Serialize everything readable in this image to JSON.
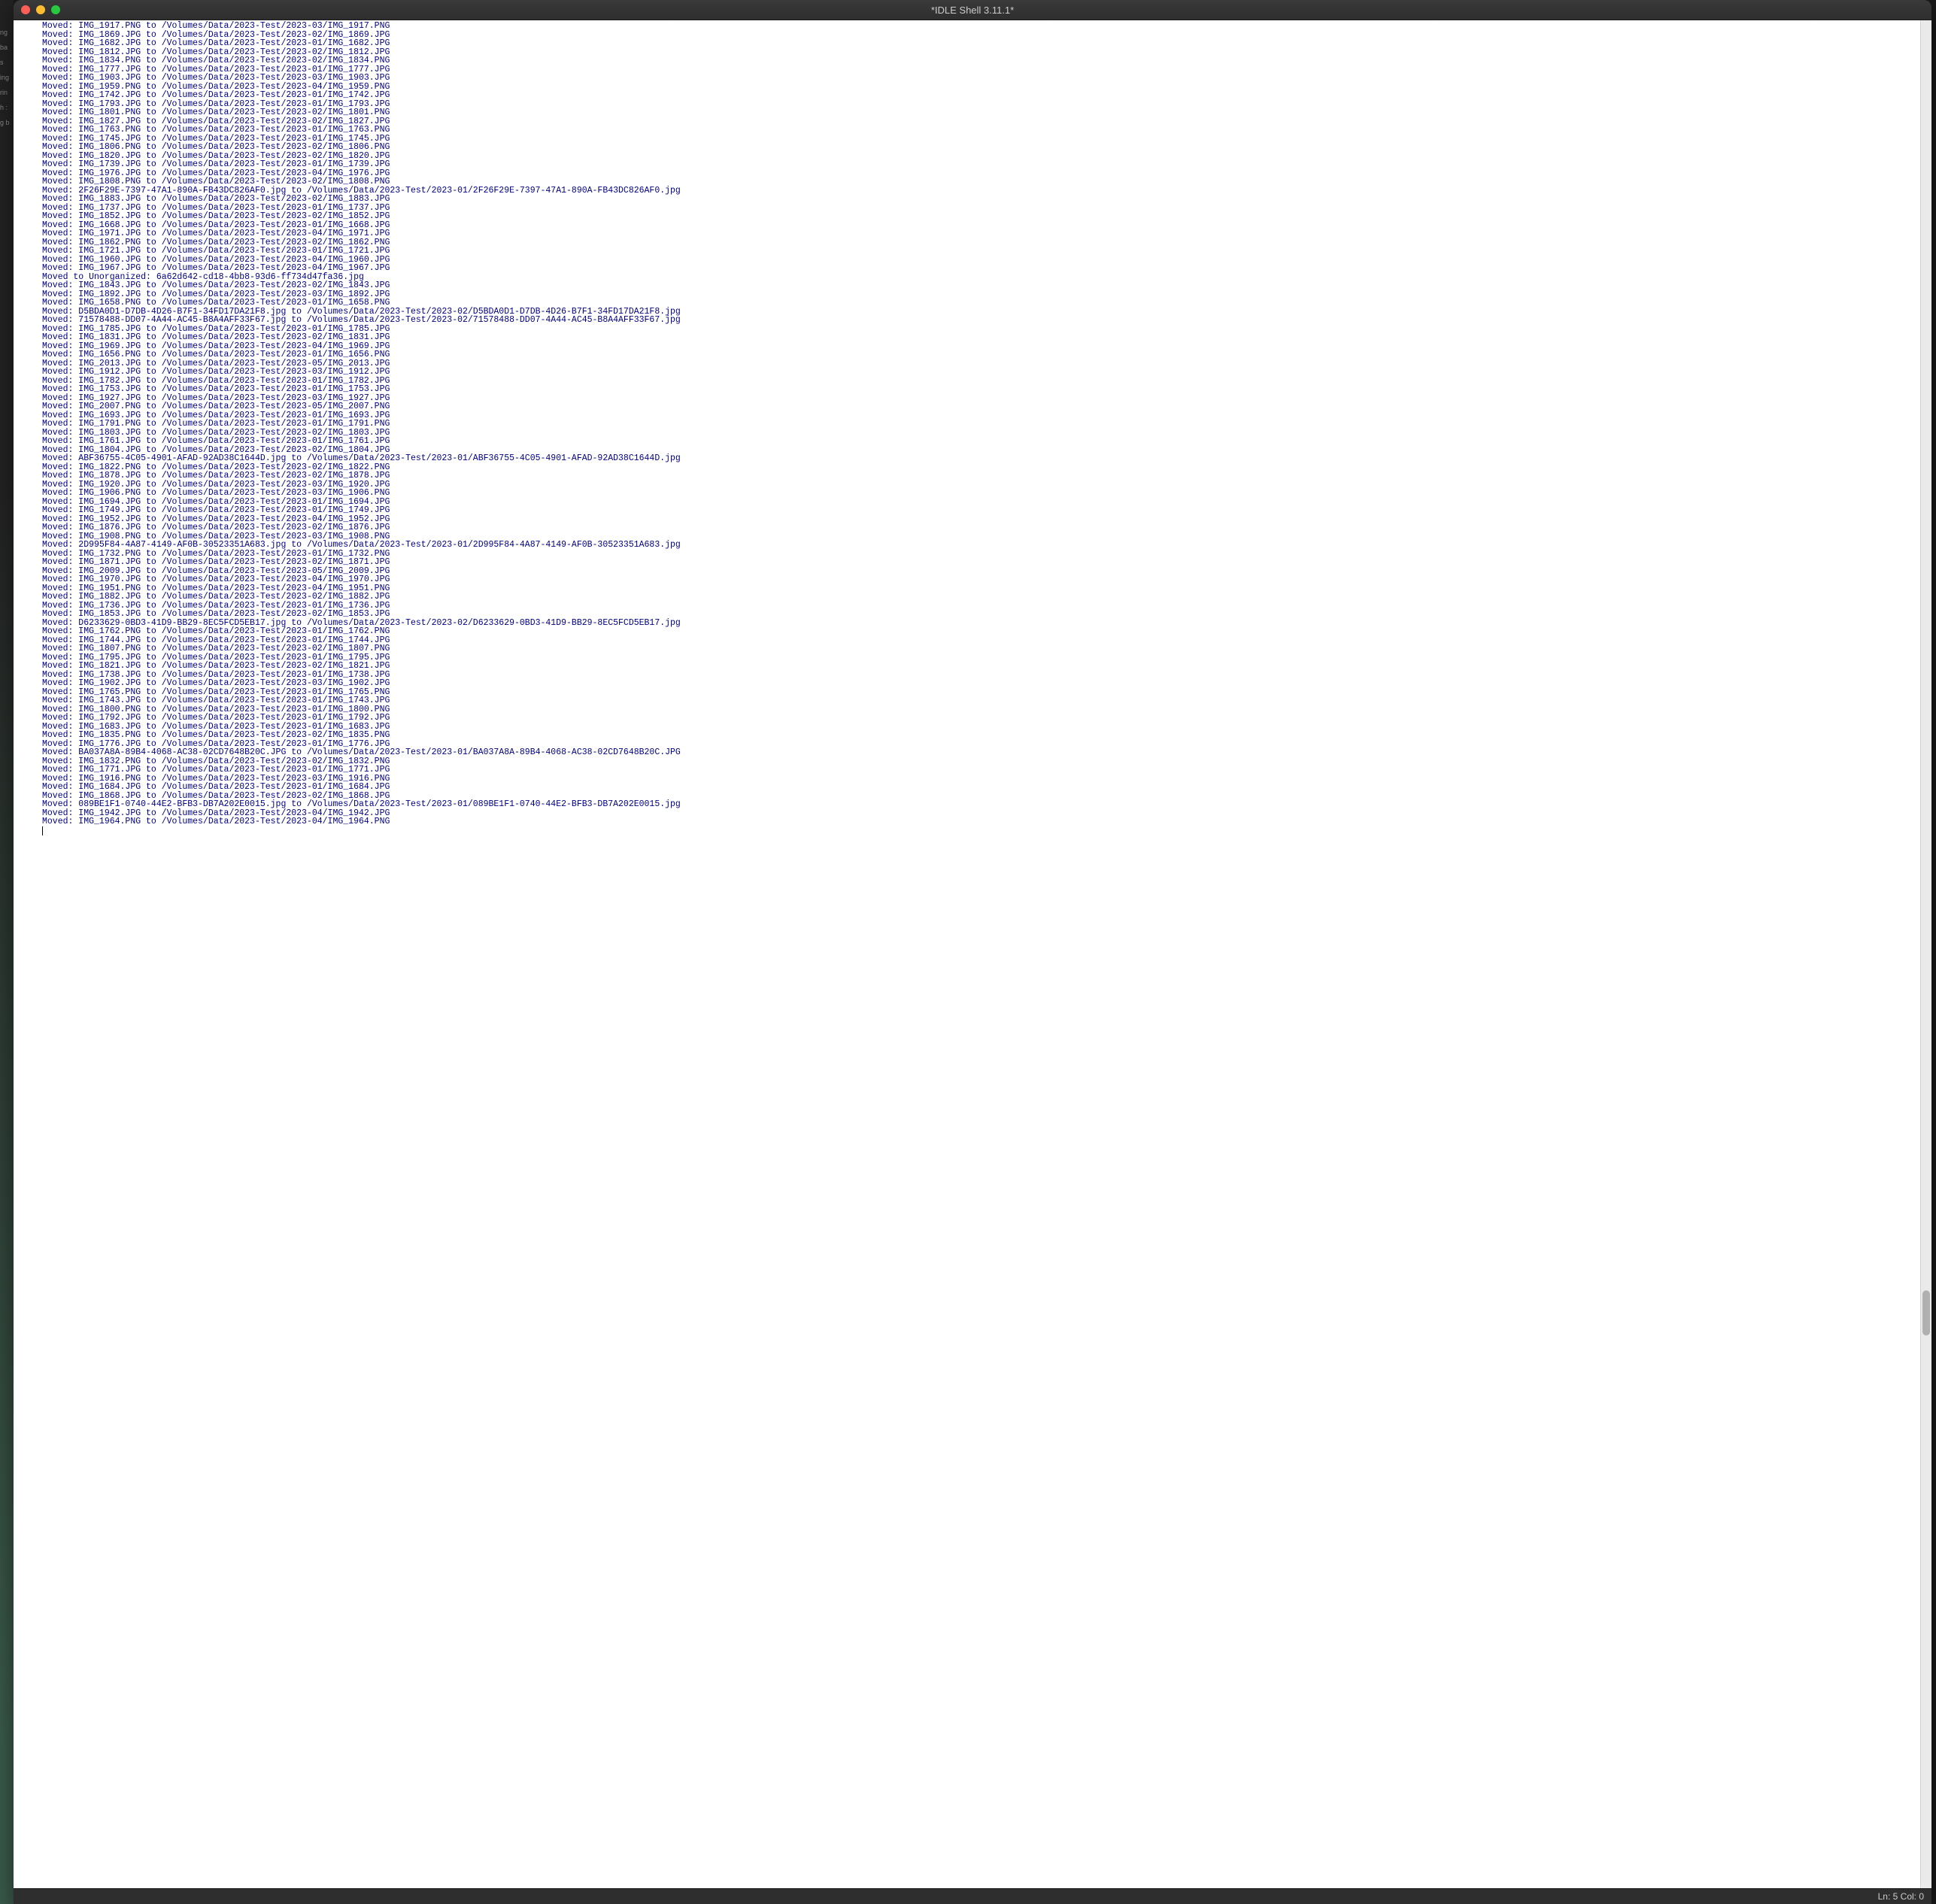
{
  "window": {
    "title": "*IDLE Shell 3.11.1*"
  },
  "statusbar": {
    "text": "Ln: 5  Col: 0"
  },
  "background_labels": [
    "ng",
    "ba",
    "s",
    "ing",
    "rin",
    "h :",
    "g b"
  ],
  "lines": [
    "Moved: IMG_1917.PNG to /Volumes/Data/2023-Test/2023-03/IMG_1917.PNG",
    "Moved: IMG_1869.JPG to /Volumes/Data/2023-Test/2023-02/IMG_1869.JPG",
    "Moved: IMG_1682.JPG to /Volumes/Data/2023-Test/2023-01/IMG_1682.JPG",
    "Moved: IMG_1812.JPG to /Volumes/Data/2023-Test/2023-02/IMG_1812.JPG",
    "Moved: IMG_1834.PNG to /Volumes/Data/2023-Test/2023-02/IMG_1834.PNG",
    "Moved: IMG_1777.JPG to /Volumes/Data/2023-Test/2023-01/IMG_1777.JPG",
    "Moved: IMG_1903.JPG to /Volumes/Data/2023-Test/2023-03/IMG_1903.JPG",
    "Moved: IMG_1959.PNG to /Volumes/Data/2023-Test/2023-04/IMG_1959.PNG",
    "Moved: IMG_1742.JPG to /Volumes/Data/2023-Test/2023-01/IMG_1742.JPG",
    "Moved: IMG_1793.JPG to /Volumes/Data/2023-Test/2023-01/IMG_1793.JPG",
    "Moved: IMG_1801.PNG to /Volumes/Data/2023-Test/2023-02/IMG_1801.PNG",
    "Moved: IMG_1827.JPG to /Volumes/Data/2023-Test/2023-02/IMG_1827.JPG",
    "Moved: IMG_1763.PNG to /Volumes/Data/2023-Test/2023-01/IMG_1763.PNG",
    "Moved: IMG_1745.JPG to /Volumes/Data/2023-Test/2023-01/IMG_1745.JPG",
    "Moved: IMG_1806.PNG to /Volumes/Data/2023-Test/2023-02/IMG_1806.PNG",
    "Moved: IMG_1820.JPG to /Volumes/Data/2023-Test/2023-02/IMG_1820.JPG",
    "Moved: IMG_1739.JPG to /Volumes/Data/2023-Test/2023-01/IMG_1739.JPG",
    "Moved: IMG_1976.JPG to /Volumes/Data/2023-Test/2023-04/IMG_1976.JPG",
    "Moved: IMG_1808.PNG to /Volumes/Data/2023-Test/2023-02/IMG_1808.PNG",
    "Moved: 2F26F29E-7397-47A1-890A-FB43DC826AF0.jpg to /Volumes/Data/2023-Test/2023-01/2F26F29E-7397-47A1-890A-FB43DC826AF0.jpg",
    "Moved: IMG_1883.JPG to /Volumes/Data/2023-Test/2023-02/IMG_1883.JPG",
    "Moved: IMG_1737.JPG to /Volumes/Data/2023-Test/2023-01/IMG_1737.JPG",
    "Moved: IMG_1852.JPG to /Volumes/Data/2023-Test/2023-02/IMG_1852.JPG",
    "Moved: IMG_1668.JPG to /Volumes/Data/2023-Test/2023-01/IMG_1668.JPG",
    "Moved: IMG_1971.JPG to /Volumes/Data/2023-Test/2023-04/IMG_1971.JPG",
    "Moved: IMG_1862.PNG to /Volumes/Data/2023-Test/2023-02/IMG_1862.PNG",
    "Moved: IMG_1721.JPG to /Volumes/Data/2023-Test/2023-01/IMG_1721.JPG",
    "Moved: IMG_1960.JPG to /Volumes/Data/2023-Test/2023-04/IMG_1960.JPG",
    "Moved: IMG_1967.JPG to /Volumes/Data/2023-Test/2023-04/IMG_1967.JPG",
    "Moved to Unorganized: 6a62d642-cd18-4bb8-93d6-ff734d47fa36.jpg",
    "Moved: IMG_1843.JPG to /Volumes/Data/2023-Test/2023-02/IMG_1843.JPG",
    "Moved: IMG_1892.JPG to /Volumes/Data/2023-Test/2023-03/IMG_1892.JPG",
    "Moved: IMG_1658.PNG to /Volumes/Data/2023-Test/2023-01/IMG_1658.PNG",
    "Moved: D5BDA0D1-D7DB-4D26-B7F1-34FD17DA21F8.jpg to /Volumes/Data/2023-Test/2023-02/D5BDA0D1-D7DB-4D26-B7F1-34FD17DA21F8.jpg",
    "Moved: 71578488-DD07-4A44-AC45-B8A4AFF33F67.jpg to /Volumes/Data/2023-Test/2023-02/71578488-DD07-4A44-AC45-B8A4AFF33F67.jpg",
    "Moved: IMG_1785.JPG to /Volumes/Data/2023-Test/2023-01/IMG_1785.JPG",
    "Moved: IMG_1831.JPG to /Volumes/Data/2023-Test/2023-02/IMG_1831.JPG",
    "Moved: IMG_1969.JPG to /Volumes/Data/2023-Test/2023-04/IMG_1969.JPG",
    "Moved: IMG_1656.PNG to /Volumes/Data/2023-Test/2023-01/IMG_1656.PNG",
    "Moved: IMG_2013.JPG to /Volumes/Data/2023-Test/2023-05/IMG_2013.JPG",
    "Moved: IMG_1912.JPG to /Volumes/Data/2023-Test/2023-03/IMG_1912.JPG",
    "Moved: IMG_1782.JPG to /Volumes/Data/2023-Test/2023-01/IMG_1782.JPG",
    "Moved: IMG_1753.JPG to /Volumes/Data/2023-Test/2023-01/IMG_1753.JPG",
    "Moved: IMG_1927.JPG to /Volumes/Data/2023-Test/2023-03/IMG_1927.JPG",
    "Moved: IMG_2007.PNG to /Volumes/Data/2023-Test/2023-05/IMG_2007.PNG",
    "Moved: IMG_1693.JPG to /Volumes/Data/2023-Test/2023-01/IMG_1693.JPG",
    "Moved: IMG_1791.PNG to /Volumes/Data/2023-Test/2023-01/IMG_1791.PNG",
    "Moved: IMG_1803.JPG to /Volumes/Data/2023-Test/2023-02/IMG_1803.JPG",
    "Moved: IMG_1761.JPG to /Volumes/Data/2023-Test/2023-01/IMG_1761.JPG",
    "Moved: IMG_1804.JPG to /Volumes/Data/2023-Test/2023-02/IMG_1804.JPG",
    "Moved: ABF36755-4C05-4901-AFAD-92AD38C1644D.jpg to /Volumes/Data/2023-Test/2023-01/ABF36755-4C05-4901-AFAD-92AD38C1644D.jpg",
    "Moved: IMG_1822.PNG to /Volumes/Data/2023-Test/2023-02/IMG_1822.PNG",
    "Moved: IMG_1878.JPG to /Volumes/Data/2023-Test/2023-02/IMG_1878.JPG",
    "Moved: IMG_1920.JPG to /Volumes/Data/2023-Test/2023-03/IMG_1920.JPG",
    "Moved: IMG_1906.PNG to /Volumes/Data/2023-Test/2023-03/IMG_1906.PNG",
    "Moved: IMG_1694.JPG to /Volumes/Data/2023-Test/2023-01/IMG_1694.JPG",
    "Moved: IMG_1749.JPG to /Volumes/Data/2023-Test/2023-01/IMG_1749.JPG",
    "Moved: IMG_1952.JPG to /Volumes/Data/2023-Test/2023-04/IMG_1952.JPG",
    "Moved: IMG_1876.JPG to /Volumes/Data/2023-Test/2023-02/IMG_1876.JPG",
    "Moved: IMG_1908.PNG to /Volumes/Data/2023-Test/2023-03/IMG_1908.PNG",
    "Moved: 2D995F84-4A87-4149-AF0B-30523351A683.jpg to /Volumes/Data/2023-Test/2023-01/2D995F84-4A87-4149-AF0B-30523351A683.jpg",
    "Moved: IMG_1732.PNG to /Volumes/Data/2023-Test/2023-01/IMG_1732.PNG",
    "Moved: IMG_1871.JPG to /Volumes/Data/2023-Test/2023-02/IMG_1871.JPG",
    "Moved: IMG_2009.JPG to /Volumes/Data/2023-Test/2023-05/IMG_2009.JPG",
    "Moved: IMG_1970.JPG to /Volumes/Data/2023-Test/2023-04/IMG_1970.JPG",
    "Moved: IMG_1951.PNG to /Volumes/Data/2023-Test/2023-04/IMG_1951.PNG",
    "Moved: IMG_1882.JPG to /Volumes/Data/2023-Test/2023-02/IMG_1882.JPG",
    "Moved: IMG_1736.JPG to /Volumes/Data/2023-Test/2023-01/IMG_1736.JPG",
    "Moved: IMG_1853.JPG to /Volumes/Data/2023-Test/2023-02/IMG_1853.JPG",
    "Moved: D6233629-0BD3-41D9-BB29-8EC5FCD5EB17.jpg to /Volumes/Data/2023-Test/2023-02/D6233629-0BD3-41D9-BB29-8EC5FCD5EB17.jpg",
    "Moved: IMG_1762.PNG to /Volumes/Data/2023-Test/2023-01/IMG_1762.PNG",
    "Moved: IMG_1744.JPG to /Volumes/Data/2023-Test/2023-01/IMG_1744.JPG",
    "Moved: IMG_1807.PNG to /Volumes/Data/2023-Test/2023-02/IMG_1807.PNG",
    "Moved: IMG_1795.JPG to /Volumes/Data/2023-Test/2023-01/IMG_1795.JPG",
    "Moved: IMG_1821.JPG to /Volumes/Data/2023-Test/2023-02/IMG_1821.JPG",
    "Moved: IMG_1738.JPG to /Volumes/Data/2023-Test/2023-01/IMG_1738.JPG",
    "Moved: IMG_1902.JPG to /Volumes/Data/2023-Test/2023-03/IMG_1902.JPG",
    "Moved: IMG_1765.PNG to /Volumes/Data/2023-Test/2023-01/IMG_1765.PNG",
    "Moved: IMG_1743.JPG to /Volumes/Data/2023-Test/2023-01/IMG_1743.JPG",
    "Moved: IMG_1800.PNG to /Volumes/Data/2023-Test/2023-01/IMG_1800.PNG",
    "Moved: IMG_1792.JPG to /Volumes/Data/2023-Test/2023-01/IMG_1792.JPG",
    "Moved: IMG_1683.JPG to /Volumes/Data/2023-Test/2023-01/IMG_1683.JPG",
    "Moved: IMG_1835.PNG to /Volumes/Data/2023-Test/2023-02/IMG_1835.PNG",
    "Moved: IMG_1776.JPG to /Volumes/Data/2023-Test/2023-01/IMG_1776.JPG",
    "Moved: BA037A8A-89B4-4068-AC38-02CD7648B20C.JPG to /Volumes/Data/2023-Test/2023-01/BA037A8A-89B4-4068-AC38-02CD7648B20C.JPG",
    "Moved: IMG_1832.PNG to /Volumes/Data/2023-Test/2023-02/IMG_1832.PNG",
    "Moved: IMG_1771.JPG to /Volumes/Data/2023-Test/2023-01/IMG_1771.JPG",
    "Moved: IMG_1916.PNG to /Volumes/Data/2023-Test/2023-03/IMG_1916.PNG",
    "Moved: IMG_1684.JPG to /Volumes/Data/2023-Test/2023-01/IMG_1684.JPG",
    "Moved: IMG_1868.JPG to /Volumes/Data/2023-Test/2023-02/IMG_1868.JPG",
    "Moved: 089BE1F1-0740-44E2-BFB3-DB7A202E0015.jpg to /Volumes/Data/2023-Test/2023-01/089BE1F1-0740-44E2-BFB3-DB7A202E0015.jpg",
    "Moved: IMG_1942.JPG to /Volumes/Data/2023-Test/2023-04/IMG_1942.JPG",
    "Moved: IMG_1964.PNG to /Volumes/Data/2023-Test/2023-04/IMG_1964.PNG"
  ]
}
